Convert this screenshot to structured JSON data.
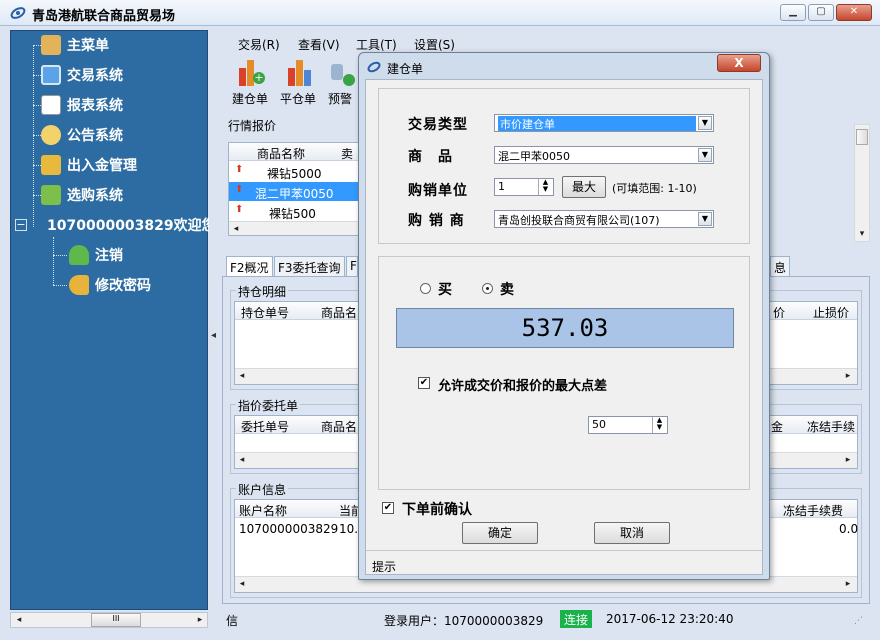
{
  "window": {
    "title": "青岛港航联合商品贸易场"
  },
  "sidebar": {
    "items": [
      {
        "label": "主菜单"
      },
      {
        "label": "交易系统"
      },
      {
        "label": "报表系统"
      },
      {
        "label": "公告系统"
      },
      {
        "label": "出入金管理"
      },
      {
        "label": "选购系统"
      },
      {
        "label": "1070000003829欢迎您"
      },
      {
        "label": "注销"
      },
      {
        "label": "修改密码"
      }
    ],
    "scroll_label": "III"
  },
  "menu": [
    "交易(R)",
    "查看(V)",
    "工具(T)",
    "设置(S)"
  ],
  "toolbar": [
    "建仓单",
    "平仓单",
    "预警"
  ],
  "quotes": {
    "title": "行情报价",
    "headers": [
      "商品名称",
      "卖"
    ],
    "rows": [
      {
        "name": "裸钻5000",
        "selected": false
      },
      {
        "name": "混二甲苯0050",
        "selected": true
      },
      {
        "name": "裸钻500",
        "selected": false
      }
    ]
  },
  "tabs": [
    "F2概况",
    "F3委托查询",
    "F",
    "息"
  ],
  "positions": {
    "title": "持仓明细",
    "headers": [
      "持仓单号",
      "商品名",
      "价",
      "止损价"
    ]
  },
  "orders": {
    "title": "指价委托单",
    "headers": [
      "委托单号",
      "商品名",
      "金",
      "冻结手续"
    ]
  },
  "account": {
    "title": "账户信息",
    "headers": [
      "账户名称",
      "当前",
      "冻结手续费"
    ],
    "row": [
      "1070000003829",
      "10.0",
      "0.0"
    ]
  },
  "status": {
    "left": "信",
    "user_label": "登录用户：1070000003829",
    "connection": "连接",
    "datetime": "2017-06-12 23:20:40"
  },
  "dialog": {
    "title": "建仓单",
    "close_label": "X",
    "trade_type": {
      "label": "交易类型",
      "value": "市价建仓单"
    },
    "product": {
      "label": "商　品",
      "value": "混二甲苯0050"
    },
    "unit": {
      "label": "购销单位",
      "value": "1",
      "max_button": "最大",
      "hint": "(可填范围: 1-10)"
    },
    "merchant": {
      "label": "购 销 商",
      "value": "青岛创投联合商贸有限公司(107)"
    },
    "buy_label": "买",
    "sell_label": "卖",
    "side_selected": "sell",
    "price": "537.03",
    "allow_diff": {
      "label": "允许成交价和报价的最大点差",
      "checked": true
    },
    "diff_value": "50",
    "confirm_before": {
      "label": "下单前确认",
      "checked": true
    },
    "ok_button": "确定",
    "cancel_button": "取消",
    "hint": "提示"
  },
  "colors": {
    "sidebar_bg": "#2d6ca2",
    "selected_row": "#3399ff",
    "price_panel": "#a9c4e6",
    "connection_bg": "#19b24b"
  }
}
